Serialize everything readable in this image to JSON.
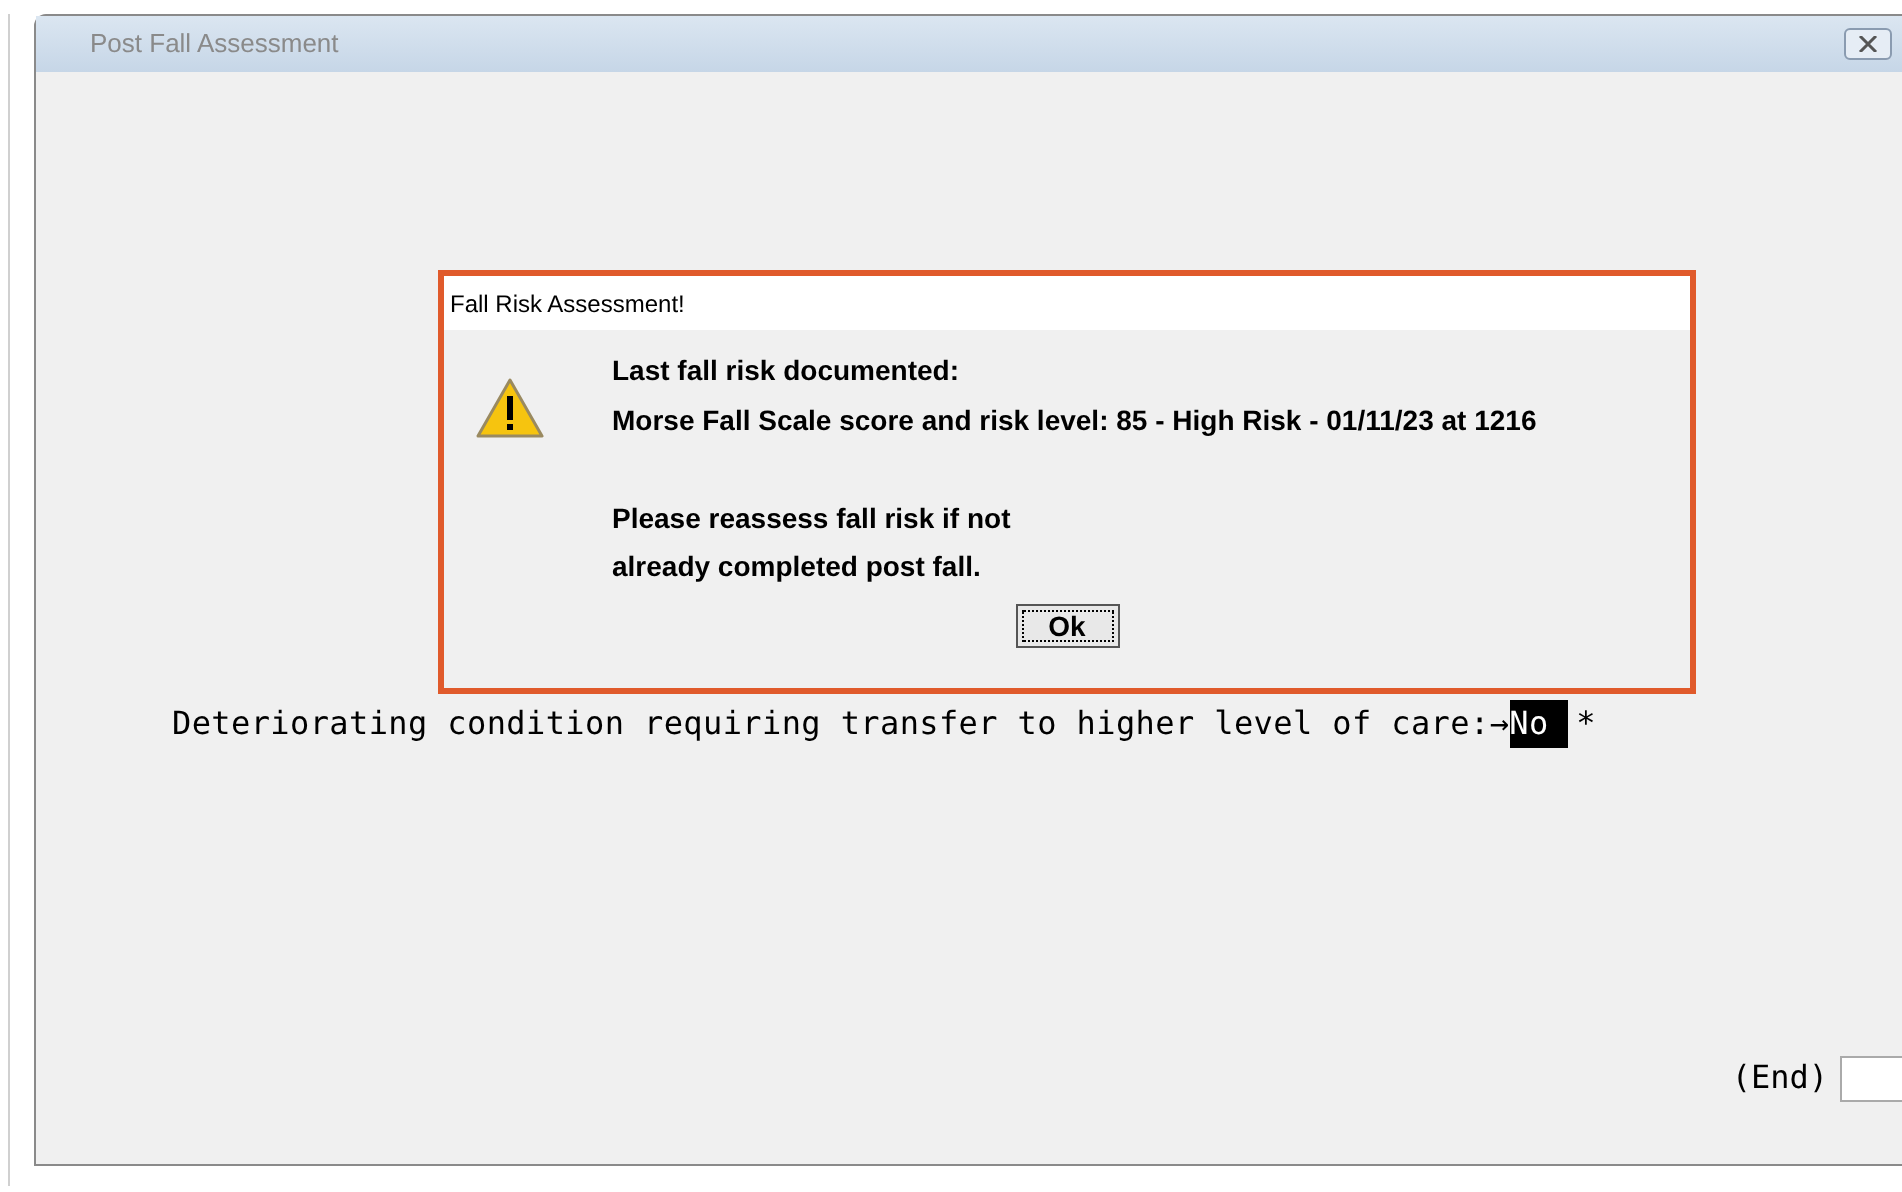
{
  "window": {
    "title": "Post Fall Assessment"
  },
  "prompt": {
    "label": "Deteriorating condition requiring transfer to higher level of care:",
    "arrow": "→",
    "value": "No ",
    "required_mark": "*"
  },
  "end": {
    "label": "(End)"
  },
  "dialog": {
    "title": "Fall Risk Assessment!",
    "paragraphs": [
      [
        "Last fall risk documented:",
        "Morse Fall Scale score and risk level: 85 - High Risk - 01/11/23 at 1216"
      ],
      [
        "Please reassess fall risk if not",
        "already completed post fall."
      ]
    ],
    "button": "Ok"
  }
}
